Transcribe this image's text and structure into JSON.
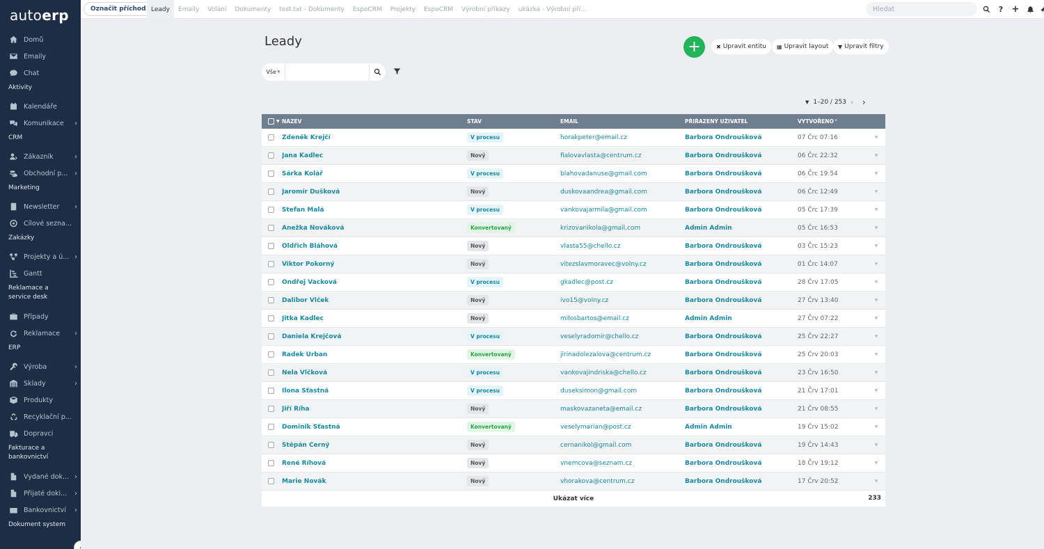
{
  "app": {
    "logo_light": "auto",
    "logo_bold": "erp"
  },
  "topbar": {
    "checkin_label": "Označit příchod",
    "tabs": [
      "Leady",
      "Emaily",
      "Volání",
      "Dokumenty",
      "test.txt - Dokumenty",
      "EspoCRM",
      "Projekty",
      "EspoCRM",
      "Výrobní příkazy",
      "ukázka - Výrobní pří..."
    ],
    "search_placeholder": "Hledat",
    "icons": [
      "search-icon",
      "help-icon",
      "plus-icon",
      "bell-icon",
      "rocket-icon"
    ],
    "help_label": "?",
    "plus_label": "+"
  },
  "sidebar": {
    "items": [
      {
        "label": "Domů",
        "icon": "home-icon",
        "chevron": false
      },
      {
        "label": "Emaily",
        "icon": "envelope-icon",
        "chevron": false
      },
      {
        "label": "Chat",
        "icon": "chat-icon",
        "chevron": false
      },
      {
        "group": "Aktivity"
      },
      {
        "label": "Kalendáře",
        "icon": "calendar-icon",
        "chevron": false
      },
      {
        "label": "Komunikace",
        "icon": "comments-icon",
        "chevron": true
      },
      {
        "group": "CRM"
      },
      {
        "label": "Zákazník",
        "icon": "customer-icon",
        "chevron": true
      },
      {
        "label": "Obchodní p...",
        "icon": "coins-icon",
        "chevron": true
      },
      {
        "group": "Marketing"
      },
      {
        "label": "Newsletter",
        "icon": "newsletter-icon",
        "chevron": true
      },
      {
        "label": "Cílové sezna...",
        "icon": "target-icon",
        "chevron": false
      },
      {
        "group": "Zakázky"
      },
      {
        "label": "Projekty a ú...",
        "icon": "projects-icon",
        "chevron": true
      },
      {
        "label": "Gantt",
        "icon": "gantt-icon",
        "chevron": false
      },
      {
        "group": "Reklamace a service desk"
      },
      {
        "label": "Případy",
        "icon": "briefcase-icon",
        "chevron": false
      },
      {
        "label": "Reklamace",
        "icon": "refresh-icon",
        "chevron": true
      },
      {
        "group": "ERP"
      },
      {
        "label": "Výroba",
        "icon": "wrench-icon",
        "chevron": true
      },
      {
        "label": "Sklady",
        "icon": "warehouse-icon",
        "chevron": true
      },
      {
        "label": "Produkty",
        "icon": "box-icon",
        "chevron": false
      },
      {
        "label": "Recyklační p...",
        "icon": "recycle-icon",
        "chevron": false
      },
      {
        "label": "Dopravci",
        "icon": "truck-icon",
        "chevron": false
      },
      {
        "group": "Fakturace a bankovnictví"
      },
      {
        "label": "Vydané dok...",
        "icon": "file-out-icon",
        "chevron": true
      },
      {
        "label": "Přijaté doki...",
        "icon": "file-in-icon",
        "chevron": true
      },
      {
        "label": "Bankovnictví",
        "icon": "bank-icon",
        "chevron": true
      },
      {
        "group": "Dokument system"
      }
    ],
    "collapse_label": "‹"
  },
  "main": {
    "title": "Leady",
    "add_label": "+",
    "actions": [
      {
        "label": "Upravit entitu",
        "icon": "tools-icon"
      },
      {
        "label": "Upravit layout",
        "icon": "layout-icon"
      },
      {
        "label": "Upravit filtry",
        "icon": "filter-icon"
      }
    ],
    "filter": {
      "scope": "Vše",
      "input_value": ""
    },
    "pager": {
      "range": "1–20 / 253"
    }
  },
  "table": {
    "columns": [
      "Název",
      "Stav",
      "Email",
      "Přiřazený uživatel",
      "Vytvořeno"
    ],
    "rows": [
      {
        "name": "Zdeněk Krejčí",
        "status": "V procesu",
        "email": "horakpeter@email.cz",
        "user": "Barbora Ondroušková",
        "created": "07 Črc 07:16"
      },
      {
        "name": "Jana Kadlec",
        "status": "Nový",
        "email": "fialovavlasta@centrum.cz",
        "user": "Barbora Ondroušková",
        "created": "06 Črc 22:32"
      },
      {
        "name": "Šárka Kolář",
        "status": "V procesu",
        "email": "blahovadanuse@gmail.com",
        "user": "Barbora Ondroušková",
        "created": "06 Črc 19:54"
      },
      {
        "name": "Jaromír Dušková",
        "status": "Nový",
        "email": "duskovaandrea@gmail.com",
        "user": "Barbora Ondroušková",
        "created": "06 Črc 12:49"
      },
      {
        "name": "Štefan Malá",
        "status": "V procesu",
        "email": "vankovajarmila@gmail.com",
        "user": "Barbora Ondroušková",
        "created": "05 Črc 17:39"
      },
      {
        "name": "Anežka Nováková",
        "status": "Konvertovaný",
        "email": "krizovanikola@gmail.com",
        "user": "Admin Admin",
        "created": "05 Črc 16:53"
      },
      {
        "name": "Oldřich Bláhová",
        "status": "Nový",
        "email": "vlasta55@chello.cz",
        "user": "Barbora Ondroušková",
        "created": "03 Črc 15:23"
      },
      {
        "name": "Viktor Pokorný",
        "status": "Nový",
        "email": "vitezslavmoravec@volny.cz",
        "user": "Barbora Ondroušková",
        "created": "01 Črc 14:07"
      },
      {
        "name": "Ondřej Vacková",
        "status": "V procesu",
        "email": "gkadlec@post.cz",
        "user": "Barbora Ondroušková",
        "created": "28 Črv 17:05"
      },
      {
        "name": "Dalibor Vlček",
        "status": "Nový",
        "email": "ivo15@volny.cz",
        "user": "Barbora Ondroušková",
        "created": "27 Črv 13:40"
      },
      {
        "name": "Jitka Kadlec",
        "status": "Nový",
        "email": "milosbartos@email.cz",
        "user": "Admin Admin",
        "created": "27 Črv 07:22"
      },
      {
        "name": "Daniela Krejčová",
        "status": "V procesu",
        "email": "veselyradomir@chello.cz",
        "user": "Barbora Ondroušková",
        "created": "25 Črv 22:27"
      },
      {
        "name": "Radek Urban",
        "status": "Konvertovaný",
        "email": "jirinadolezalova@centrum.cz",
        "user": "Barbora Ondroušková",
        "created": "25 Črv 20:03"
      },
      {
        "name": "Nela Vlčková",
        "status": "V procesu",
        "email": "vankovajindriska@chello.cz",
        "user": "Barbora Ondroušková",
        "created": "23 Črv 16:50"
      },
      {
        "name": "Ilona Šťastná",
        "status": "V procesu",
        "email": "duseksimon@gmail.com",
        "user": "Barbora Ondroušková",
        "created": "21 Črv 17:01"
      },
      {
        "name": "Jiří Říha",
        "status": "Nový",
        "email": "maskovazaneta@email.cz",
        "user": "Barbora Ondroušková",
        "created": "21 Črv 08:55"
      },
      {
        "name": "Dominik Šťastná",
        "status": "Konvertovaný",
        "email": "veselymarian@post.cz",
        "user": "Admin Admin",
        "created": "19 Črv 15:02"
      },
      {
        "name": "Štěpán Černý",
        "status": "Nový",
        "email": "cernanikol@gmail.com",
        "user": "Barbora Ondroušková",
        "created": "19 Črv 14:43"
      },
      {
        "name": "René Říhová",
        "status": "Nový",
        "email": "vnemcova@seznam.cz",
        "user": "Barbora Ondroušková",
        "created": "18 Črv 19:12"
      },
      {
        "name": "Marie Novák",
        "status": "Nový",
        "email": "vhorakova@centrum.cz",
        "user": "Barbora Ondroušková",
        "created": "17 Črv 20:52"
      }
    ],
    "show_more": "Ukázat více",
    "total": "233"
  },
  "colors": {
    "sidebar_bg": "#1d2e44",
    "accent_link": "#1a88a0",
    "add_button": "#24b35a",
    "table_header": "#6e7d8f",
    "status_process": "#1a88a0",
    "status_converted": "#27a34a"
  }
}
